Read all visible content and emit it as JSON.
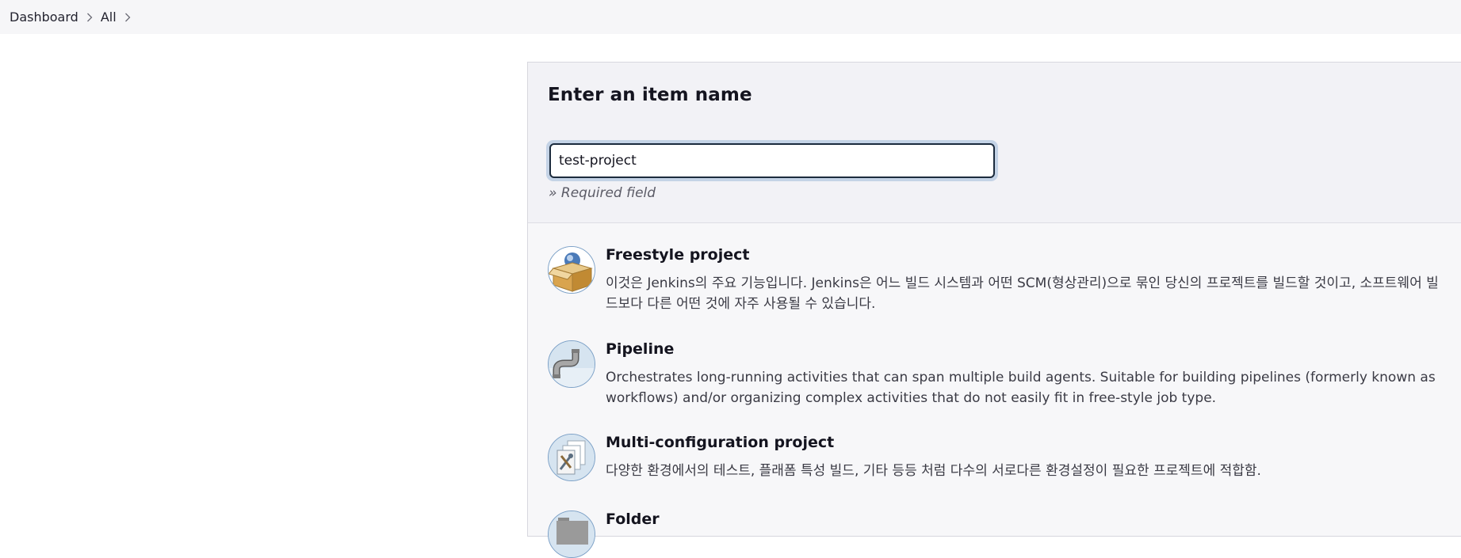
{
  "breadcrumb": {
    "items": [
      {
        "label": "Dashboard"
      },
      {
        "label": "All"
      }
    ]
  },
  "form": {
    "heading": "Enter an item name",
    "item_name_value": "test-project",
    "required_hint": "» Required field"
  },
  "item_types": [
    {
      "title": "Freestyle project",
      "description": "이것은 Jenkins의 주요 기능입니다. Jenkins은 어느 빌드 시스템과 어떤 SCM(형상관리)으로 묶인 당신의 프로젝트를 빌드할 것이고, 소프트웨어 빌드보다 다른 어떤 것에 자주 사용될 수 있습니다.",
      "icon": "freestyle-box-icon"
    },
    {
      "title": "Pipeline",
      "description": "Orchestrates long-running activities that can span multiple build agents. Suitable for building pipelines (formerly known as workflows) and/or organizing complex activities that do not easily fit in free-style job type.",
      "icon": "pipeline-pipe-icon"
    },
    {
      "title": "Multi-configuration project",
      "description": "다양한 환경에서의 테스트, 플래폼 특성 빌드, 기타 등등 처럼 다수의 서로다른 환경설정이 필요한 프로젝트에 적합함.",
      "icon": "multi-config-icon"
    },
    {
      "title": "Folder",
      "description": "",
      "icon": "folder-icon"
    }
  ],
  "colors": {
    "breadcrumb_bg": "#f6f6f8",
    "panel_bg": "#f7f7f9",
    "input_focus_ring": "#c4d3e6",
    "input_border": "#1c2b3d"
  }
}
